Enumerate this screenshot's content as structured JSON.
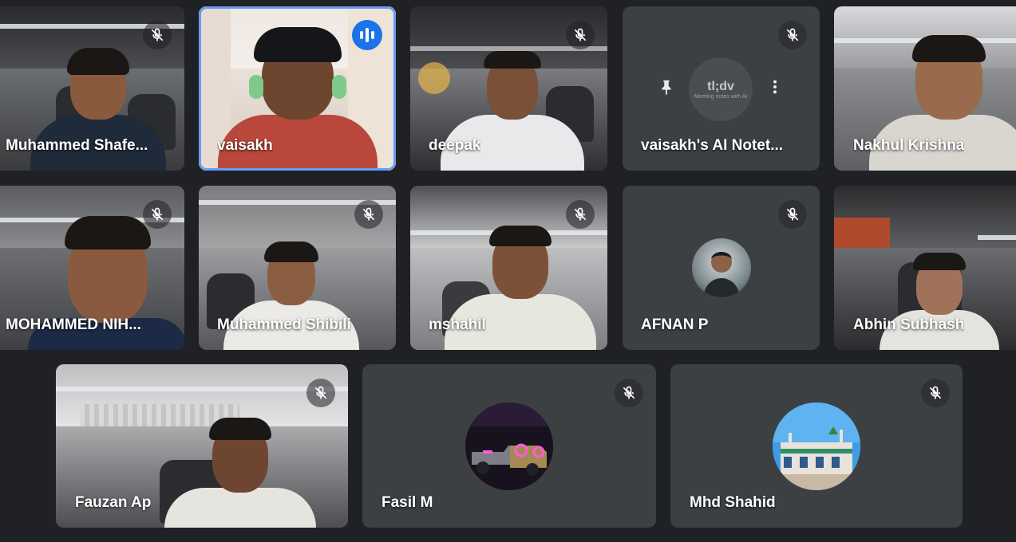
{
  "participants": [
    {
      "name": "Muhammed Shafe...",
      "muted": true
    },
    {
      "name": "vaisakh",
      "speaking": true
    },
    {
      "name": "deepak",
      "muted": true
    },
    {
      "name": "vaisakh's AI Notet...",
      "muted": true,
      "logo_text": "tl;dv",
      "logo_sub": "Meeting notes with AI"
    },
    {
      "name": "Nakhul Krishna"
    },
    {
      "name": "MOHAMMED NIH...",
      "muted": true
    },
    {
      "name": "Muhammed Shibili",
      "muted": true
    },
    {
      "name": "mshahil",
      "muted": true
    },
    {
      "name": "AFNAN P",
      "muted": true
    },
    {
      "name": "Abhin Subhash"
    },
    {
      "name": "Fauzan Ap",
      "muted": true
    },
    {
      "name": "Fasil M",
      "muted": true
    },
    {
      "name": "Mhd Shahid",
      "muted": true
    }
  ],
  "icons": {
    "mic_off": "mic-off-icon",
    "pin": "pin-icon",
    "more": "more-vert-icon",
    "speaking": "audio-level-icon"
  },
  "colors": {
    "background": "#202124",
    "tile": "#3c4043",
    "speaking_border": "#669df6",
    "speaking_badge": "#1a73e8"
  }
}
